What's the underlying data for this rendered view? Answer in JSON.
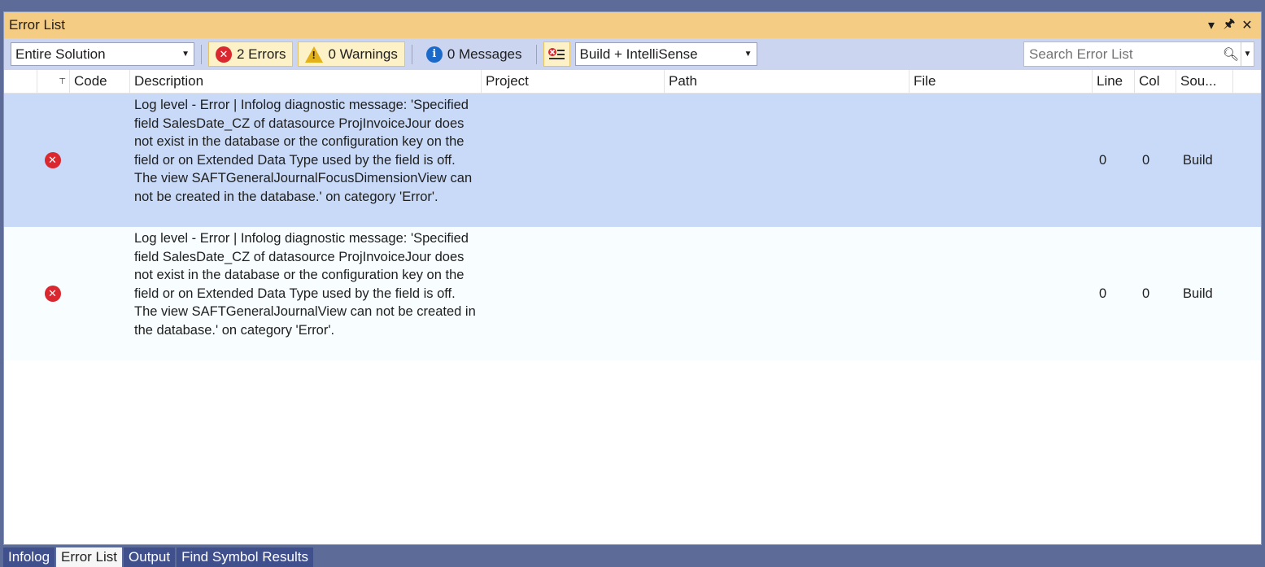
{
  "window": {
    "title": "Error List"
  },
  "toolbar": {
    "scope": "Entire Solution",
    "errors_label": "2 Errors",
    "warnings_label": "0 Warnings",
    "messages_label": "0 Messages",
    "build_filter": "Build + IntelliSense",
    "search_placeholder": "Search Error List"
  },
  "columns": [
    "Code",
    "Description",
    "Project",
    "Path",
    "File",
    "Line",
    "Col",
    "Sou..."
  ],
  "rows": [
    {
      "code": "",
      "description": "Log level - Error | Infolog diagnostic message: 'Specified field SalesDate_CZ of datasource ProjInvoiceJour does not exist in the database or the configuration key on the field or on Extended Data Type used by the field is off. The view SAFTGeneralJournalFocusDimensionView can not be created in the database.' on category 'Error'.",
      "project": "",
      "path": "",
      "file": "",
      "line": "0",
      "col": "0",
      "source": "Build"
    },
    {
      "code": "",
      "description": "Log level - Error | Infolog diagnostic message: 'Specified field SalesDate_CZ of datasource ProjInvoiceJour does not exist in the database or the configuration key on the field or on Extended Data Type used by the field is off. The view SAFTGeneralJournalView can not be created in the database.' on category 'Error'.",
      "project": "",
      "path": "",
      "file": "",
      "line": "0",
      "col": "0",
      "source": "Build"
    }
  ],
  "tabs": [
    "Infolog",
    "Error List",
    "Output",
    "Find Symbol Results"
  ],
  "colors": {
    "title_bar": "#f5cc84",
    "toolbar": "#ccd5f0",
    "selected_row": "#c9daf8",
    "tab_strip": "#5d6b99"
  }
}
